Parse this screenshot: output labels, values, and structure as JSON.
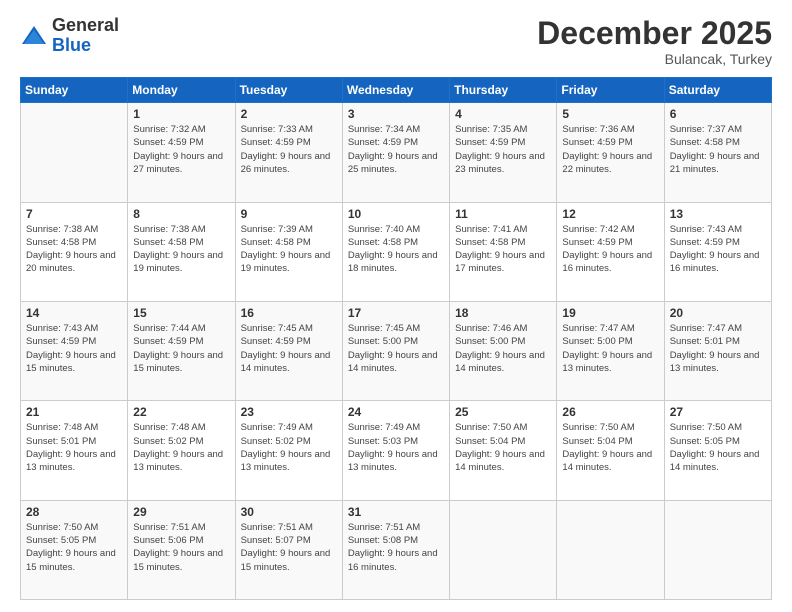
{
  "logo": {
    "general": "General",
    "blue": "Blue"
  },
  "header": {
    "month": "December 2025",
    "location": "Bulancak, Turkey"
  },
  "days_of_week": [
    "Sunday",
    "Monday",
    "Tuesday",
    "Wednesday",
    "Thursday",
    "Friday",
    "Saturday"
  ],
  "weeks": [
    [
      {
        "day": "",
        "sunrise": "",
        "sunset": "",
        "daylight": ""
      },
      {
        "day": "1",
        "sunrise": "Sunrise: 7:32 AM",
        "sunset": "Sunset: 4:59 PM",
        "daylight": "Daylight: 9 hours and 27 minutes."
      },
      {
        "day": "2",
        "sunrise": "Sunrise: 7:33 AM",
        "sunset": "Sunset: 4:59 PM",
        "daylight": "Daylight: 9 hours and 26 minutes."
      },
      {
        "day": "3",
        "sunrise": "Sunrise: 7:34 AM",
        "sunset": "Sunset: 4:59 PM",
        "daylight": "Daylight: 9 hours and 25 minutes."
      },
      {
        "day": "4",
        "sunrise": "Sunrise: 7:35 AM",
        "sunset": "Sunset: 4:59 PM",
        "daylight": "Daylight: 9 hours and 23 minutes."
      },
      {
        "day": "5",
        "sunrise": "Sunrise: 7:36 AM",
        "sunset": "Sunset: 4:59 PM",
        "daylight": "Daylight: 9 hours and 22 minutes."
      },
      {
        "day": "6",
        "sunrise": "Sunrise: 7:37 AM",
        "sunset": "Sunset: 4:58 PM",
        "daylight": "Daylight: 9 hours and 21 minutes."
      }
    ],
    [
      {
        "day": "7",
        "sunrise": "Sunrise: 7:38 AM",
        "sunset": "Sunset: 4:58 PM",
        "daylight": "Daylight: 9 hours and 20 minutes."
      },
      {
        "day": "8",
        "sunrise": "Sunrise: 7:38 AM",
        "sunset": "Sunset: 4:58 PM",
        "daylight": "Daylight: 9 hours and 19 minutes."
      },
      {
        "day": "9",
        "sunrise": "Sunrise: 7:39 AM",
        "sunset": "Sunset: 4:58 PM",
        "daylight": "Daylight: 9 hours and 19 minutes."
      },
      {
        "day": "10",
        "sunrise": "Sunrise: 7:40 AM",
        "sunset": "Sunset: 4:58 PM",
        "daylight": "Daylight: 9 hours and 18 minutes."
      },
      {
        "day": "11",
        "sunrise": "Sunrise: 7:41 AM",
        "sunset": "Sunset: 4:58 PM",
        "daylight": "Daylight: 9 hours and 17 minutes."
      },
      {
        "day": "12",
        "sunrise": "Sunrise: 7:42 AM",
        "sunset": "Sunset: 4:59 PM",
        "daylight": "Daylight: 9 hours and 16 minutes."
      },
      {
        "day": "13",
        "sunrise": "Sunrise: 7:43 AM",
        "sunset": "Sunset: 4:59 PM",
        "daylight": "Daylight: 9 hours and 16 minutes."
      }
    ],
    [
      {
        "day": "14",
        "sunrise": "Sunrise: 7:43 AM",
        "sunset": "Sunset: 4:59 PM",
        "daylight": "Daylight: 9 hours and 15 minutes."
      },
      {
        "day": "15",
        "sunrise": "Sunrise: 7:44 AM",
        "sunset": "Sunset: 4:59 PM",
        "daylight": "Daylight: 9 hours and 15 minutes."
      },
      {
        "day": "16",
        "sunrise": "Sunrise: 7:45 AM",
        "sunset": "Sunset: 4:59 PM",
        "daylight": "Daylight: 9 hours and 14 minutes."
      },
      {
        "day": "17",
        "sunrise": "Sunrise: 7:45 AM",
        "sunset": "Sunset: 5:00 PM",
        "daylight": "Daylight: 9 hours and 14 minutes."
      },
      {
        "day": "18",
        "sunrise": "Sunrise: 7:46 AM",
        "sunset": "Sunset: 5:00 PM",
        "daylight": "Daylight: 9 hours and 14 minutes."
      },
      {
        "day": "19",
        "sunrise": "Sunrise: 7:47 AM",
        "sunset": "Sunset: 5:00 PM",
        "daylight": "Daylight: 9 hours and 13 minutes."
      },
      {
        "day": "20",
        "sunrise": "Sunrise: 7:47 AM",
        "sunset": "Sunset: 5:01 PM",
        "daylight": "Daylight: 9 hours and 13 minutes."
      }
    ],
    [
      {
        "day": "21",
        "sunrise": "Sunrise: 7:48 AM",
        "sunset": "Sunset: 5:01 PM",
        "daylight": "Daylight: 9 hours and 13 minutes."
      },
      {
        "day": "22",
        "sunrise": "Sunrise: 7:48 AM",
        "sunset": "Sunset: 5:02 PM",
        "daylight": "Daylight: 9 hours and 13 minutes."
      },
      {
        "day": "23",
        "sunrise": "Sunrise: 7:49 AM",
        "sunset": "Sunset: 5:02 PM",
        "daylight": "Daylight: 9 hours and 13 minutes."
      },
      {
        "day": "24",
        "sunrise": "Sunrise: 7:49 AM",
        "sunset": "Sunset: 5:03 PM",
        "daylight": "Daylight: 9 hours and 13 minutes."
      },
      {
        "day": "25",
        "sunrise": "Sunrise: 7:50 AM",
        "sunset": "Sunset: 5:04 PM",
        "daylight": "Daylight: 9 hours and 14 minutes."
      },
      {
        "day": "26",
        "sunrise": "Sunrise: 7:50 AM",
        "sunset": "Sunset: 5:04 PM",
        "daylight": "Daylight: 9 hours and 14 minutes."
      },
      {
        "day": "27",
        "sunrise": "Sunrise: 7:50 AM",
        "sunset": "Sunset: 5:05 PM",
        "daylight": "Daylight: 9 hours and 14 minutes."
      }
    ],
    [
      {
        "day": "28",
        "sunrise": "Sunrise: 7:50 AM",
        "sunset": "Sunset: 5:05 PM",
        "daylight": "Daylight: 9 hours and 15 minutes."
      },
      {
        "day": "29",
        "sunrise": "Sunrise: 7:51 AM",
        "sunset": "Sunset: 5:06 PM",
        "daylight": "Daylight: 9 hours and 15 minutes."
      },
      {
        "day": "30",
        "sunrise": "Sunrise: 7:51 AM",
        "sunset": "Sunset: 5:07 PM",
        "daylight": "Daylight: 9 hours and 15 minutes."
      },
      {
        "day": "31",
        "sunrise": "Sunrise: 7:51 AM",
        "sunset": "Sunset: 5:08 PM",
        "daylight": "Daylight: 9 hours and 16 minutes."
      },
      {
        "day": "",
        "sunrise": "",
        "sunset": "",
        "daylight": ""
      },
      {
        "day": "",
        "sunrise": "",
        "sunset": "",
        "daylight": ""
      },
      {
        "day": "",
        "sunrise": "",
        "sunset": "",
        "daylight": ""
      }
    ]
  ]
}
